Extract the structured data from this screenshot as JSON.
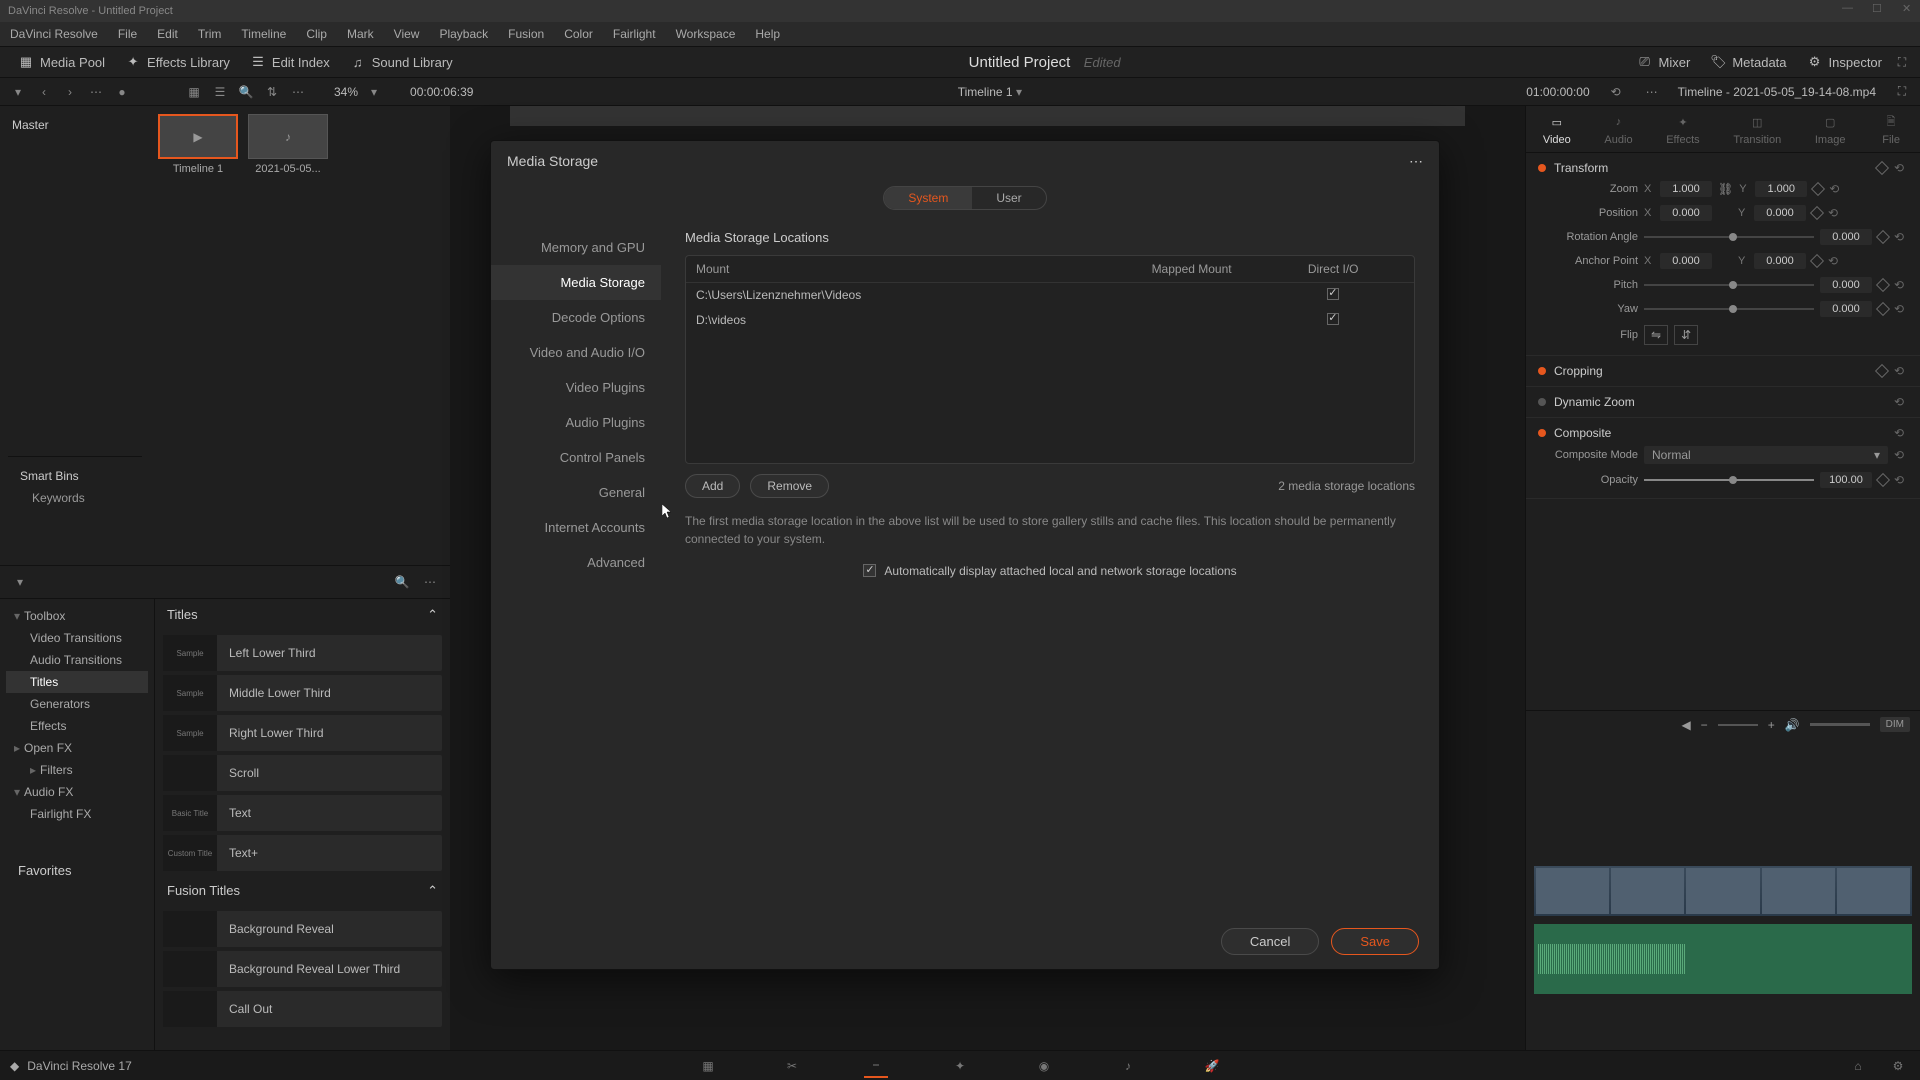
{
  "titlebar": {
    "text": "DaVinci Resolve - Untitled Project"
  },
  "menu": [
    "DaVinci Resolve",
    "File",
    "Edit",
    "Trim",
    "Timeline",
    "Clip",
    "Mark",
    "View",
    "Playback",
    "Fusion",
    "Color",
    "Fairlight",
    "Workspace",
    "Help"
  ],
  "toolbar": {
    "media_pool": "Media Pool",
    "effects_library": "Effects Library",
    "edit_index": "Edit Index",
    "sound_library": "Sound Library",
    "mixer": "Mixer",
    "metadata": "Metadata",
    "inspector": "Inspector"
  },
  "project": {
    "title": "Untitled Project",
    "edited": "Edited"
  },
  "subbar": {
    "zoom": "34%",
    "timecode_left": "00:00:06:39",
    "timeline_name": "Timeline 1",
    "timecode_right": "01:00:00:00",
    "clip_name": "Timeline - 2021-05-05_19-14-08.mp4"
  },
  "media": {
    "master": "Master",
    "clips": [
      {
        "name": "Timeline 1",
        "selected": true
      },
      {
        "name": "2021-05-05...",
        "selected": false
      }
    ],
    "smart_bins": "Smart Bins",
    "keywords": "Keywords"
  },
  "fx": {
    "tree": [
      {
        "label": "Toolbox",
        "indent": 0,
        "chev": "▾"
      },
      {
        "label": "Video Transitions",
        "indent": 1
      },
      {
        "label": "Audio Transitions",
        "indent": 1
      },
      {
        "label": "Titles",
        "indent": 1,
        "sel": true
      },
      {
        "label": "Generators",
        "indent": 1
      },
      {
        "label": "Effects",
        "indent": 1
      },
      {
        "label": "Open FX",
        "indent": 0,
        "chev": "▸"
      },
      {
        "label": "Filters",
        "indent": 1,
        "chev": "▸"
      },
      {
        "label": "Audio FX",
        "indent": 0,
        "chev": "▾"
      },
      {
        "label": "Fairlight FX",
        "indent": 1
      }
    ],
    "favorites": "Favorites",
    "section_titles": "Titles",
    "section_fusion": "Fusion Titles",
    "titles": [
      "Left Lower Third",
      "Middle Lower Third",
      "Right Lower Third",
      "Scroll",
      "Text",
      "Text+"
    ],
    "title_thumbs": [
      "Sample",
      "Sample",
      "Sample",
      "",
      "Basic Title",
      "Custom Title"
    ],
    "fusion_titles": [
      "Background Reveal",
      "Background Reveal Lower Third",
      "Call Out"
    ]
  },
  "inspector": {
    "tabs": [
      "Video",
      "Audio",
      "Effects",
      "Transition",
      "Image",
      "File"
    ],
    "transform": "Transform",
    "zoom_lbl": "Zoom",
    "zoom_x": "1.000",
    "zoom_y": "1.000",
    "pos_lbl": "Position",
    "pos_x": "0.000",
    "pos_y": "0.000",
    "rot_lbl": "Rotation Angle",
    "rot": "0.000",
    "anchor_lbl": "Anchor Point",
    "anchor_x": "0.000",
    "anchor_y": "0.000",
    "pitch_lbl": "Pitch",
    "pitch": "0.000",
    "yaw_lbl": "Yaw",
    "yaw": "0.000",
    "flip_lbl": "Flip",
    "cropping": "Cropping",
    "dynamic_zoom": "Dynamic Zoom",
    "composite": "Composite",
    "comp_mode_lbl": "Composite Mode",
    "comp_mode": "Normal",
    "opacity_lbl": "Opacity",
    "opacity": "100.00"
  },
  "dialog": {
    "title": "Media Storage",
    "tab_system": "System",
    "tab_user": "User",
    "nav": [
      "Memory and GPU",
      "Media Storage",
      "Decode Options",
      "Video and Audio I/O",
      "Video Plugins",
      "Audio Plugins",
      "Control Panels",
      "General",
      "Internet Accounts",
      "Advanced"
    ],
    "nav_active": 1,
    "section": "Media Storage Locations",
    "cols": {
      "mount": "Mount",
      "mapped": "Mapped Mount",
      "dio": "Direct I/O"
    },
    "rows": [
      {
        "mount": "C:\\Users\\Lizenznehmer\\Videos",
        "dio": true
      },
      {
        "mount": "D:\\videos",
        "dio": true
      }
    ],
    "add": "Add",
    "remove": "Remove",
    "count": "2 media storage locations",
    "note": "The first media storage location in the above list will be used to store gallery stills and cache files. This location should be permanently connected to your system.",
    "auto_display": "Automatically display attached local and network storage locations",
    "cancel": "Cancel",
    "save": "Save"
  },
  "footer": {
    "app": "DaVinci Resolve 17"
  },
  "audio": {
    "dim": "DIM"
  }
}
